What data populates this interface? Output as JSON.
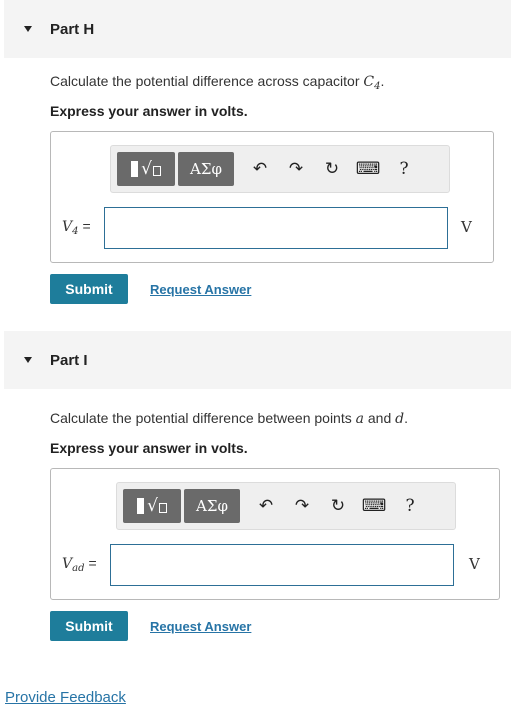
{
  "partH": {
    "title": "Part H",
    "prompt": "Calculate the potential difference across capacitor",
    "prompt_var": "C",
    "prompt_sub": "4",
    "prompt_end": ".",
    "instruction": "Express your answer in volts.",
    "var_label": "V",
    "var_sub": "4",
    "eq": "=",
    "input_value": "",
    "unit": "V",
    "submit": "Submit",
    "request": "Request Answer"
  },
  "partI": {
    "title": "Part I",
    "prompt_pre": "Calculate the potential difference between points",
    "prompt_a": "a",
    "prompt_and": "and",
    "prompt_d": "d",
    "prompt_end": ".",
    "instruction": "Express your answer in volts.",
    "var_label": "V",
    "var_sub": "ad",
    "eq": "=",
    "input_value": "",
    "unit": "V",
    "submit": "Submit",
    "request": "Request Answer"
  },
  "toolbar": {
    "greek": "ΑΣφ",
    "undo": "↶",
    "redo": "↷",
    "reset": "↻",
    "keyboard": "⌨",
    "help": "?",
    "radical": "√"
  },
  "footer": {
    "feedback": "Provide Feedback"
  }
}
